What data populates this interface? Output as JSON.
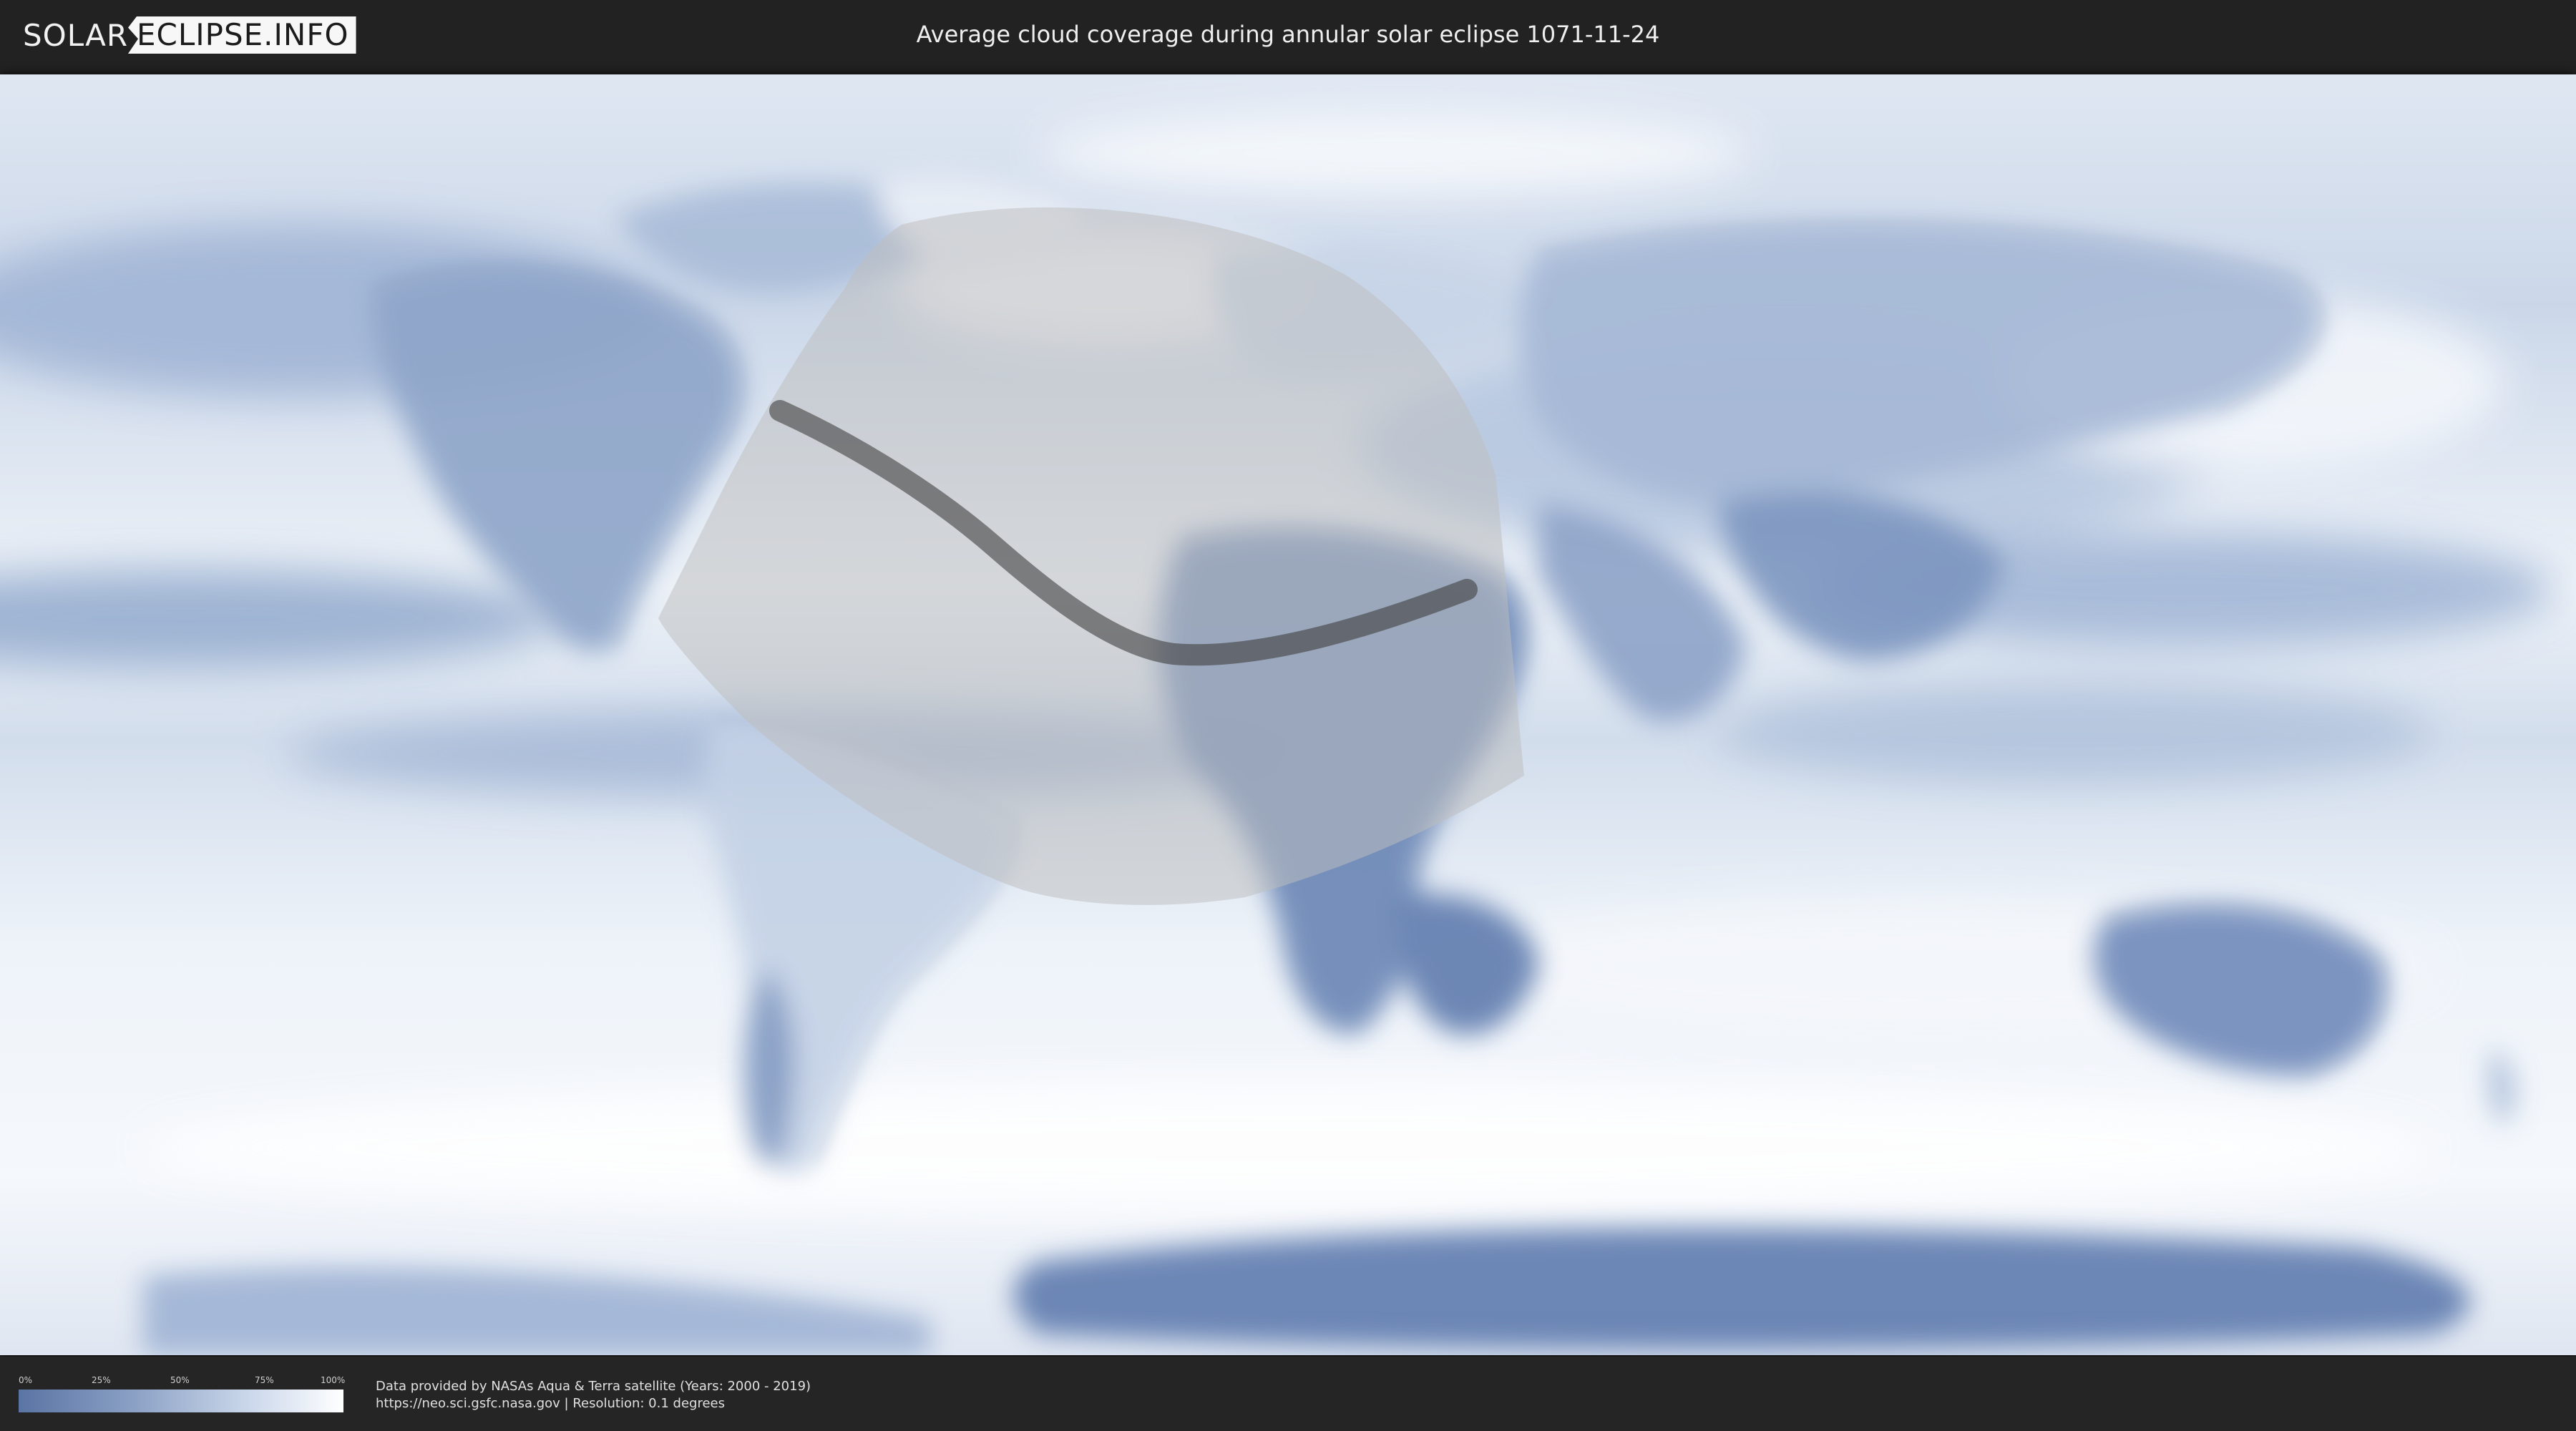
{
  "brand": {
    "logo_left": "SOLAR",
    "logo_right": "ECLIPSE.INFO"
  },
  "header": {
    "title": "Average cloud coverage during annular solar eclipse 1071-11-24"
  },
  "map": {
    "type": "world-map",
    "projection": "equirectangular",
    "layer": "average cloud coverage",
    "eclipse_type": "annular",
    "eclipse_date": "1071-11-24",
    "colors": {
      "ocean_low_cloud": "#6f8fbf",
      "clear_land": "#5d78a8",
      "full_cloud": "#ffffff",
      "penumbra_shadow": "#bdbdbd",
      "central_path": "#3f3f3f"
    }
  },
  "legend": {
    "ticks": [
      "0%",
      "25%",
      "50%",
      "75%",
      "100%"
    ],
    "colors": [
      "#5a74a4",
      "#ffffff"
    ]
  },
  "credits": {
    "line1": "Data provided by NASAs Aqua & Terra satellite (Years: 2000 - 2019)",
    "line2": "https://neo.sci.gsfc.nasa.gov | Resolution: 0.1 degrees"
  }
}
